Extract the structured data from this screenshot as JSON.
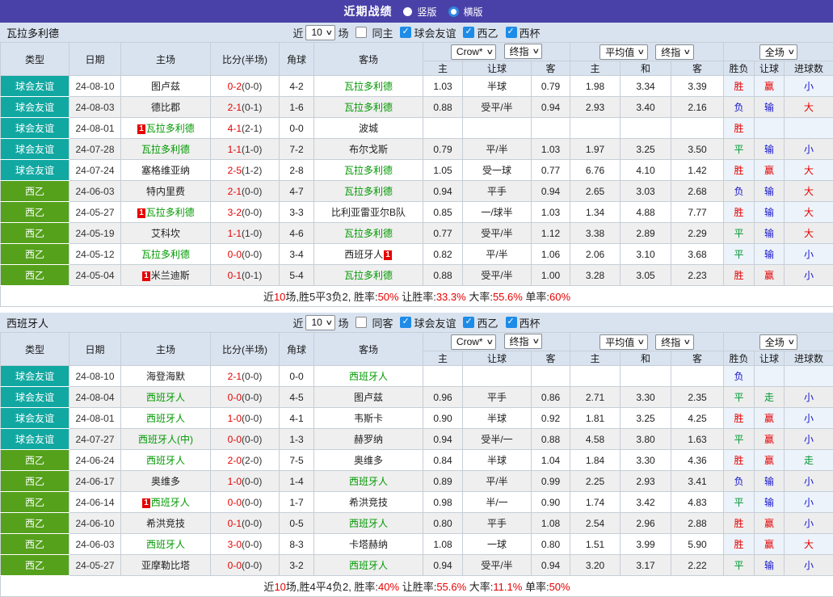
{
  "banner": {
    "title": "近期战绩",
    "radios": [
      {
        "label": "竖版",
        "selected": false
      },
      {
        "label": "横版",
        "selected": true
      }
    ]
  },
  "header": {
    "cols": [
      "类型",
      "日期",
      "主场",
      "比分(半场)",
      "角球",
      "客场"
    ],
    "selects": {
      "crow": "Crow*",
      "final1": "终指",
      "avg": "平均值",
      "final2": "终指",
      "scope": "全场"
    },
    "sub": [
      "主",
      "让球",
      "客",
      "主",
      "和",
      "客",
      "胜负",
      "让球",
      "进球数"
    ]
  },
  "colors": {
    "banner": "#4a41a8",
    "friendly_teal": "#12a8a2",
    "league_green": "#55a11c",
    "win_red": "#e60000",
    "lose_blue": "#1414cc",
    "draw_green": "#009933",
    "focus_team_green": "#009900",
    "header_bg": "#d9e3f0",
    "crow_col_bg": "#fcf5ec",
    "avg_col_bg": "#e8f2f9"
  },
  "sections": [
    {
      "team": "瓦拉多利德",
      "filter": {
        "near": "近",
        "count": "10",
        "games": "场",
        "same": {
          "label": "同主",
          "checked": false
        },
        "leagues": [
          {
            "label": "球会友谊",
            "checked": true
          },
          {
            "label": "西乙",
            "checked": true
          },
          {
            "label": "西杯",
            "checked": true
          }
        ]
      },
      "rows": [
        {
          "t": "球会友谊",
          "tc": "teal",
          "d": "24-08-10",
          "h": {
            "n": "图卢兹"
          },
          "s": "0-2",
          "sh": "(0-0)",
          "c": "4-2",
          "a": {
            "n": "瓦拉多利德",
            "f": 1
          },
          "o": [
            "1.03",
            "半球",
            "0.79",
            "1.98",
            "3.34",
            "3.39"
          ],
          "r": [
            [
              "胜",
              "r"
            ],
            [
              "赢",
              "r"
            ],
            [
              "小",
              "b"
            ]
          ]
        },
        {
          "t": "球会友谊",
          "tc": "teal",
          "d": "24-08-03",
          "h": {
            "n": "德比郡"
          },
          "s": "2-1",
          "sh": "(0-1)",
          "c": "1-6",
          "a": {
            "n": "瓦拉多利德",
            "f": 1
          },
          "o": [
            "0.88",
            "受平/半",
            "0.94",
            "2.93",
            "3.40",
            "2.16"
          ],
          "r": [
            [
              "负",
              "b"
            ],
            [
              "输",
              "b"
            ],
            [
              "大",
              "r"
            ]
          ]
        },
        {
          "t": "球会友谊",
          "tc": "teal",
          "d": "24-08-01",
          "h": {
            "n": "瓦拉多利德",
            "f": 1,
            "b": "1"
          },
          "s": "4-1",
          "sh": "(2-1)",
          "c": "0-0",
          "a": {
            "n": "波城"
          },
          "o": [
            "",
            "",
            "",
            "",
            "",
            ""
          ],
          "r": [
            [
              "胜",
              "r"
            ],
            [
              "",
              ""
            ],
            [
              "",
              ""
            ]
          ]
        },
        {
          "t": "球会友谊",
          "tc": "teal",
          "d": "24-07-28",
          "h": {
            "n": "瓦拉多利德",
            "f": 1
          },
          "s": "1-1",
          "sh": "(1-0)",
          "c": "7-2",
          "a": {
            "n": "布尔戈斯"
          },
          "o": [
            "0.79",
            "平/半",
            "1.03",
            "1.97",
            "3.25",
            "3.50"
          ],
          "r": [
            [
              "平",
              "g"
            ],
            [
              "输",
              "b"
            ],
            [
              "小",
              "b"
            ]
          ]
        },
        {
          "t": "球会友谊",
          "tc": "teal",
          "d": "24-07-24",
          "h": {
            "n": "塞格维亚纳"
          },
          "s": "2-5",
          "sh": "(1-2)",
          "c": "2-8",
          "a": {
            "n": "瓦拉多利德",
            "f": 1
          },
          "o": [
            "1.05",
            "受一球",
            "0.77",
            "6.76",
            "4.10",
            "1.42"
          ],
          "r": [
            [
              "胜",
              "r"
            ],
            [
              "赢",
              "r"
            ],
            [
              "大",
              "r"
            ]
          ]
        },
        {
          "t": "西乙",
          "tc": "green",
          "d": "24-06-03",
          "h": {
            "n": "特内里费"
          },
          "s": "2-1",
          "sh": "(0-0)",
          "c": "4-7",
          "a": {
            "n": "瓦拉多利德",
            "f": 1
          },
          "o": [
            "0.94",
            "平手",
            "0.94",
            "2.65",
            "3.03",
            "2.68"
          ],
          "r": [
            [
              "负",
              "b"
            ],
            [
              "输",
              "b"
            ],
            [
              "大",
              "r"
            ]
          ]
        },
        {
          "t": "西乙",
          "tc": "green",
          "d": "24-05-27",
          "h": {
            "n": "瓦拉多利德",
            "f": 1,
            "b": "1"
          },
          "s": "3-2",
          "sh": "(0-0)",
          "c": "3-3",
          "a": {
            "n": "比利亚雷亚尔B队"
          },
          "o": [
            "0.85",
            "一/球半",
            "1.03",
            "1.34",
            "4.88",
            "7.77"
          ],
          "r": [
            [
              "胜",
              "r"
            ],
            [
              "输",
              "b"
            ],
            [
              "大",
              "r"
            ]
          ]
        },
        {
          "t": "西乙",
          "tc": "green",
          "d": "24-05-19",
          "h": {
            "n": "艾科坎"
          },
          "s": "1-1",
          "sh": "(1-0)",
          "c": "4-6",
          "a": {
            "n": "瓦拉多利德",
            "f": 1
          },
          "o": [
            "0.77",
            "受平/半",
            "1.12",
            "3.38",
            "2.89",
            "2.29"
          ],
          "r": [
            [
              "平",
              "g"
            ],
            [
              "输",
              "b"
            ],
            [
              "大",
              "r"
            ]
          ]
        },
        {
          "t": "西乙",
          "tc": "green",
          "d": "24-05-12",
          "h": {
            "n": "瓦拉多利德",
            "f": 1
          },
          "s": "0-0",
          "sh": "(0-0)",
          "c": "3-4",
          "a": {
            "n": "西班牙人",
            "b": "1",
            "bs": "r"
          },
          "o": [
            "0.82",
            "平/半",
            "1.06",
            "2.06",
            "3.10",
            "3.68"
          ],
          "r": [
            [
              "平",
              "g"
            ],
            [
              "输",
              "b"
            ],
            [
              "小",
              "b"
            ]
          ]
        },
        {
          "t": "西乙",
          "tc": "green",
          "d": "24-05-04",
          "h": {
            "n": "米兰迪斯",
            "b": "1"
          },
          "s": "0-1",
          "sh": "(0-1)",
          "c": "5-4",
          "a": {
            "n": "瓦拉多利德",
            "f": 1
          },
          "o": [
            "0.88",
            "受平/半",
            "1.00",
            "3.28",
            "3.05",
            "2.23"
          ],
          "r": [
            [
              "胜",
              "r"
            ],
            [
              "赢",
              "r"
            ],
            [
              "小",
              "b"
            ]
          ]
        }
      ],
      "summary": [
        [
          "近",
          ""
        ],
        [
          "10",
          "r"
        ],
        [
          "场,胜5平3负2, 胜率:",
          ""
        ],
        [
          "50%",
          "r"
        ],
        [
          " 让胜率:",
          ""
        ],
        [
          "33.3%",
          "r"
        ],
        [
          " 大率:",
          ""
        ],
        [
          "55.6%",
          "r"
        ],
        [
          " 单率:",
          ""
        ],
        [
          "60%",
          "r"
        ]
      ]
    },
    {
      "team": "西班牙人",
      "filter": {
        "near": "近",
        "count": "10",
        "games": "场",
        "same": {
          "label": "同客",
          "checked": false
        },
        "leagues": [
          {
            "label": "球会友谊",
            "checked": true
          },
          {
            "label": "西乙",
            "checked": true
          },
          {
            "label": "西杯",
            "checked": true
          }
        ]
      },
      "rows": [
        {
          "t": "球会友谊",
          "tc": "teal",
          "d": "24-08-10",
          "h": {
            "n": "海登海默"
          },
          "s": "2-1",
          "sh": "(0-0)",
          "c": "0-0",
          "a": {
            "n": "西班牙人",
            "f": 1
          },
          "o": [
            "",
            "",
            "",
            "",
            "",
            ""
          ],
          "r": [
            [
              "负",
              "b"
            ],
            [
              "",
              ""
            ],
            [
              "",
              ""
            ]
          ]
        },
        {
          "t": "球会友谊",
          "tc": "teal",
          "d": "24-08-04",
          "h": {
            "n": "西班牙人",
            "f": 1
          },
          "s": "0-0",
          "sh": "(0-0)",
          "c": "4-5",
          "a": {
            "n": "图卢兹"
          },
          "o": [
            "0.96",
            "平手",
            "0.86",
            "2.71",
            "3.30",
            "2.35"
          ],
          "r": [
            [
              "平",
              "g"
            ],
            [
              "走",
              "g"
            ],
            [
              "小",
              "b"
            ]
          ]
        },
        {
          "t": "球会友谊",
          "tc": "teal",
          "d": "24-08-01",
          "h": {
            "n": "西班牙人",
            "f": 1
          },
          "s": "1-0",
          "sh": "(0-0)",
          "c": "4-1",
          "a": {
            "n": "韦斯卡"
          },
          "o": [
            "0.90",
            "半球",
            "0.92",
            "1.81",
            "3.25",
            "4.25"
          ],
          "r": [
            [
              "胜",
              "r"
            ],
            [
              "赢",
              "r"
            ],
            [
              "小",
              "b"
            ]
          ]
        },
        {
          "t": "球会友谊",
          "tc": "teal",
          "d": "24-07-27",
          "h": {
            "n": "西班牙人(中)",
            "f": 1
          },
          "s": "0-0",
          "sh": "(0-0)",
          "c": "1-3",
          "a": {
            "n": "赫罗纳"
          },
          "o": [
            "0.94",
            "受半/一",
            "0.88",
            "4.58",
            "3.80",
            "1.63"
          ],
          "r": [
            [
              "平",
              "g"
            ],
            [
              "赢",
              "r"
            ],
            [
              "小",
              "b"
            ]
          ]
        },
        {
          "t": "西乙",
          "tc": "green",
          "d": "24-06-24",
          "h": {
            "n": "西班牙人",
            "f": 1
          },
          "s": "2-0",
          "sh": "(2-0)",
          "c": "7-5",
          "a": {
            "n": "奥维多"
          },
          "o": [
            "0.84",
            "半球",
            "1.04",
            "1.84",
            "3.30",
            "4.36"
          ],
          "r": [
            [
              "胜",
              "r"
            ],
            [
              "赢",
              "r"
            ],
            [
              "走",
              "g"
            ]
          ]
        },
        {
          "t": "西乙",
          "tc": "green",
          "d": "24-06-17",
          "h": {
            "n": "奥维多"
          },
          "s": "1-0",
          "sh": "(0-0)",
          "c": "1-4",
          "a": {
            "n": "西班牙人",
            "f": 1
          },
          "o": [
            "0.89",
            "平/半",
            "0.99",
            "2.25",
            "2.93",
            "3.41"
          ],
          "r": [
            [
              "负",
              "b"
            ],
            [
              "输",
              "b"
            ],
            [
              "小",
              "b"
            ]
          ]
        },
        {
          "t": "西乙",
          "tc": "green",
          "d": "24-06-14",
          "h": {
            "n": "西班牙人",
            "f": 1,
            "b": "1"
          },
          "s": "0-0",
          "sh": "(0-0)",
          "c": "1-7",
          "a": {
            "n": "希洪竞技"
          },
          "o": [
            "0.98",
            "半/一",
            "0.90",
            "1.74",
            "3.42",
            "4.83"
          ],
          "r": [
            [
              "平",
              "g"
            ],
            [
              "输",
              "b"
            ],
            [
              "小",
              "b"
            ]
          ]
        },
        {
          "t": "西乙",
          "tc": "green",
          "d": "24-06-10",
          "h": {
            "n": "希洪竞技"
          },
          "s": "0-1",
          "sh": "(0-0)",
          "c": "0-5",
          "a": {
            "n": "西班牙人",
            "f": 1
          },
          "o": [
            "0.80",
            "平手",
            "1.08",
            "2.54",
            "2.96",
            "2.88"
          ],
          "r": [
            [
              "胜",
              "r"
            ],
            [
              "赢",
              "r"
            ],
            [
              "小",
              "b"
            ]
          ]
        },
        {
          "t": "西乙",
          "tc": "green",
          "d": "24-06-03",
          "h": {
            "n": "西班牙人",
            "f": 1
          },
          "s": "3-0",
          "sh": "(0-0)",
          "c": "8-3",
          "a": {
            "n": "卡塔赫纳"
          },
          "o": [
            "1.08",
            "一球",
            "0.80",
            "1.51",
            "3.99",
            "5.90"
          ],
          "r": [
            [
              "胜",
              "r"
            ],
            [
              "赢",
              "r"
            ],
            [
              "大",
              "r"
            ]
          ]
        },
        {
          "t": "西乙",
          "tc": "green",
          "d": "24-05-27",
          "h": {
            "n": "亚摩勒比塔"
          },
          "s": "0-0",
          "sh": "(0-0)",
          "c": "3-2",
          "a": {
            "n": "西班牙人",
            "f": 1
          },
          "o": [
            "0.94",
            "受平/半",
            "0.94",
            "3.20",
            "3.17",
            "2.22"
          ],
          "r": [
            [
              "平",
              "g"
            ],
            [
              "输",
              "b"
            ],
            [
              "小",
              "b"
            ]
          ]
        }
      ],
      "summary": [
        [
          "近",
          ""
        ],
        [
          "10",
          "r"
        ],
        [
          "场,胜4平4负2, 胜率:",
          ""
        ],
        [
          "40%",
          "r"
        ],
        [
          " 让胜率:",
          ""
        ],
        [
          "55.6%",
          "r"
        ],
        [
          " 大率:",
          ""
        ],
        [
          "11.1%",
          "r"
        ],
        [
          " 单率:",
          ""
        ],
        [
          "50%",
          "r"
        ]
      ]
    }
  ]
}
